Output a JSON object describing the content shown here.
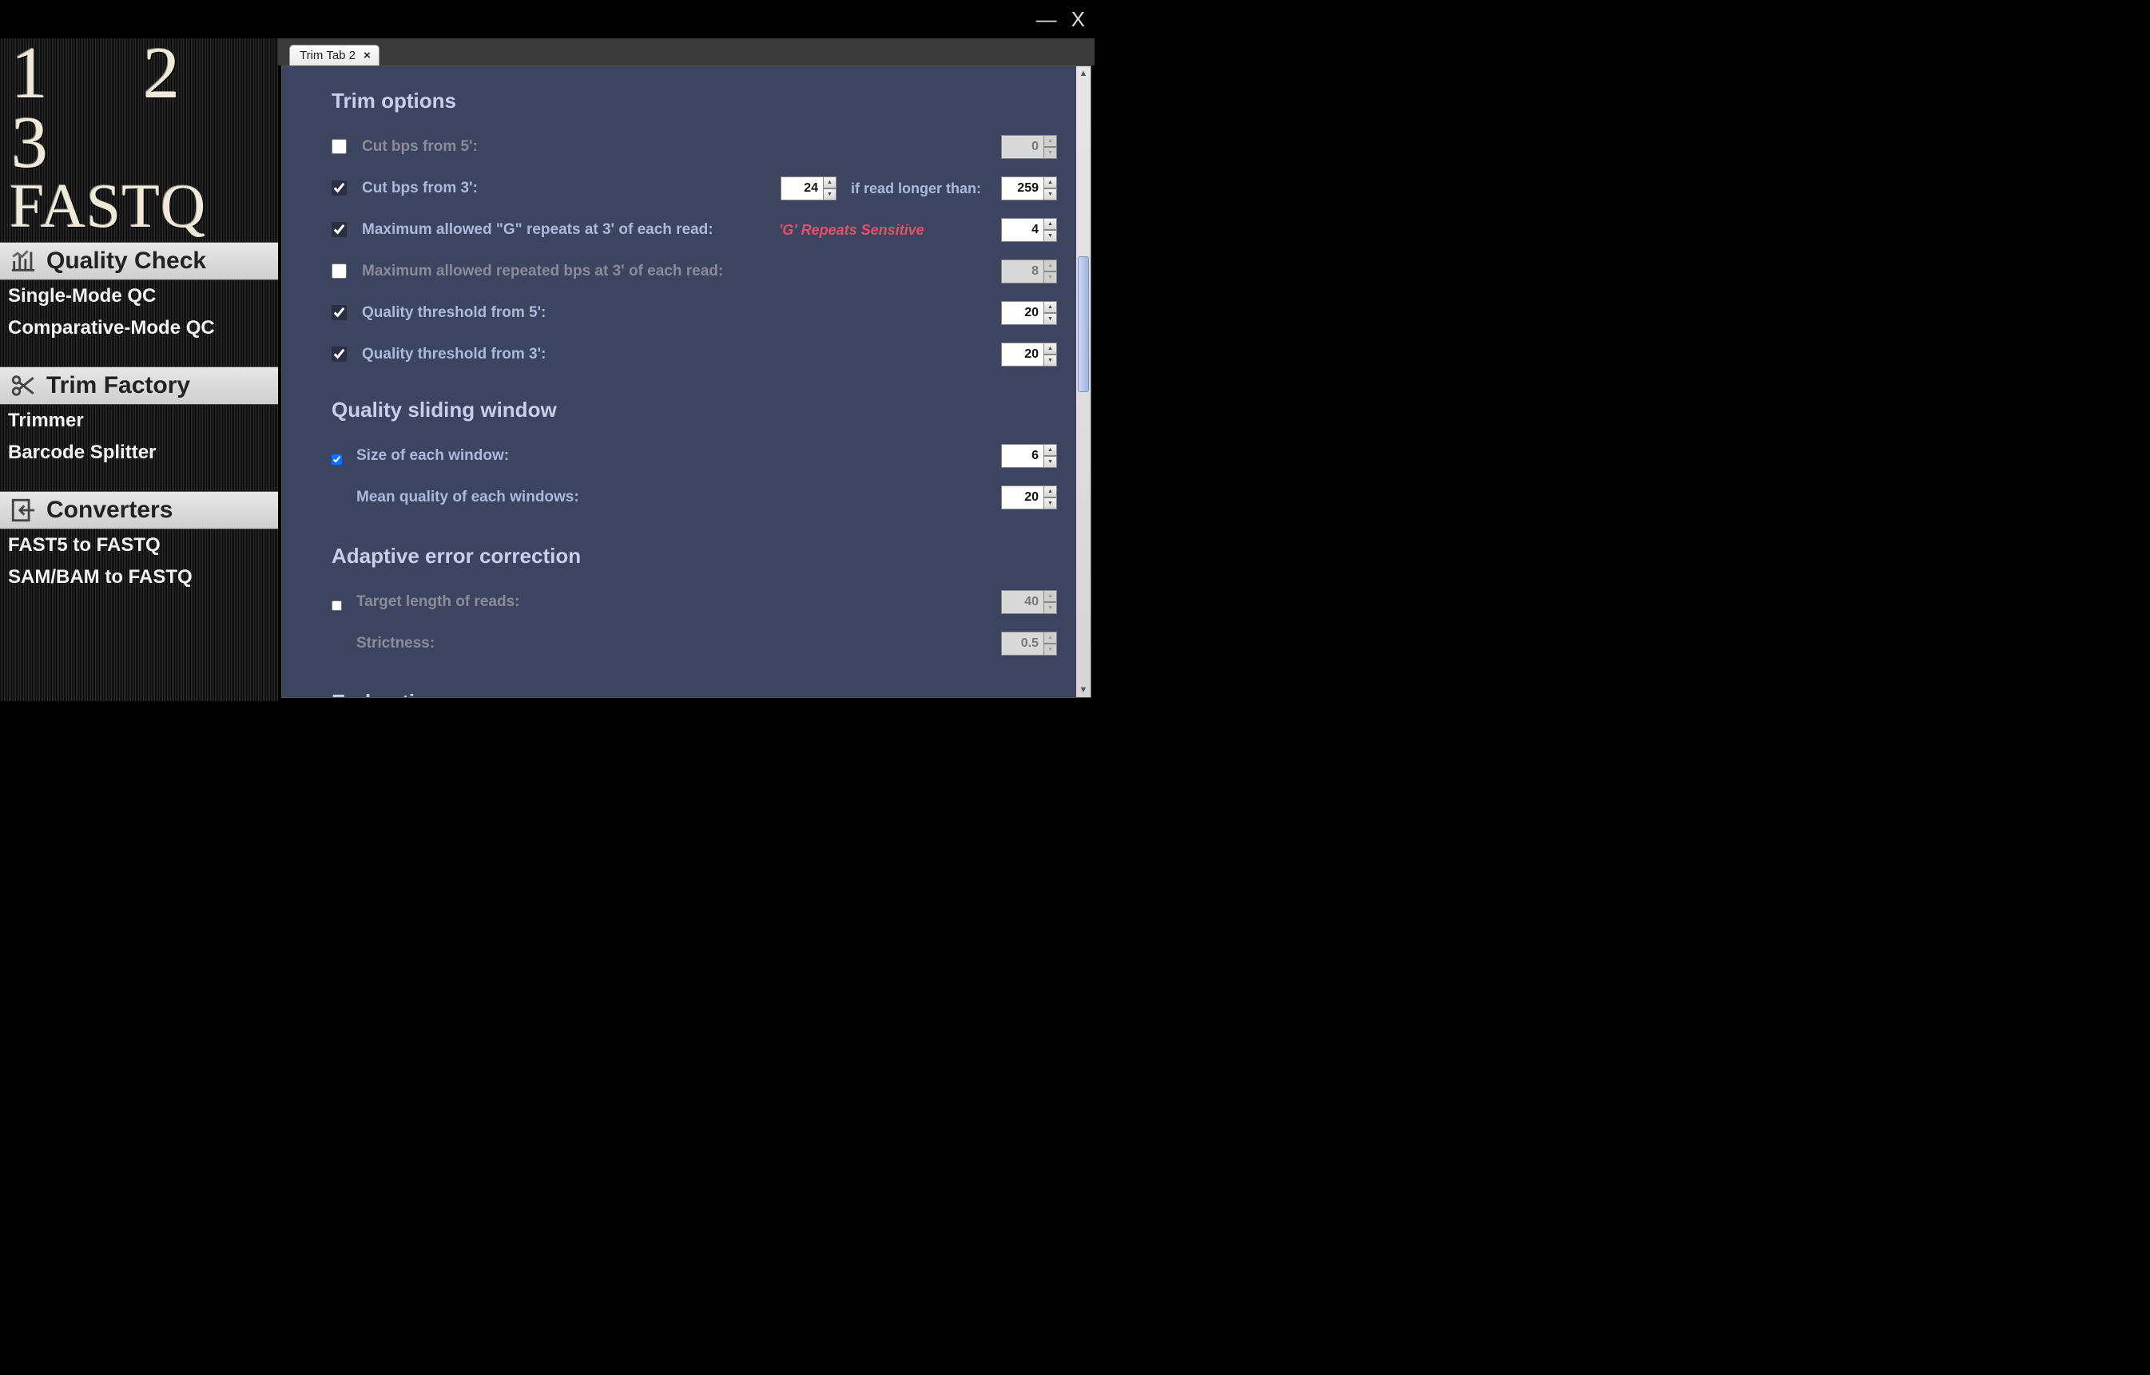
{
  "titlebar": {
    "minimize": "—",
    "close": "X"
  },
  "logo": {
    "numbers": "1 2 3",
    "word": "FASTQ"
  },
  "sidebar": {
    "sections": [
      {
        "header": "Quality Check",
        "icon": "bar-chart-icon",
        "items": [
          "Single-Mode QC",
          "Comparative-Mode QC"
        ]
      },
      {
        "header": "Trim Factory",
        "icon": "scissors-icon",
        "items": [
          "Trimmer",
          "Barcode Splitter"
        ]
      },
      {
        "header": "Converters",
        "icon": "import-icon",
        "items": [
          "FAST5 to FASTQ",
          "SAM/BAM to FASTQ"
        ]
      }
    ]
  },
  "tab": {
    "label": "Trim Tab 2",
    "close": "×"
  },
  "sections": {
    "trim_options": "Trim options",
    "sliding": "Quality sliding window",
    "adaptive": "Adaptive error correction",
    "end": "End options"
  },
  "rows": {
    "cut5": {
      "checked": false,
      "label": "Cut bps from 5':",
      "value": "0"
    },
    "cut3": {
      "checked": true,
      "label": "Cut bps from 3':",
      "value": "24",
      "mid_label": "if read longer than:",
      "value2": "259"
    },
    "maxG": {
      "checked": true,
      "label": "Maximum allowed \"G\" repeats at 3' of each read:",
      "mid_label": "'G' Repeats Sensitive",
      "value": "4"
    },
    "maxRep": {
      "checked": false,
      "label": "Maximum allowed repeated bps at 3' of each read:",
      "value": "8"
    },
    "q5": {
      "checked": true,
      "label": "Quality threshold from 5':",
      "value": "20"
    },
    "q3": {
      "checked": true,
      "label": "Quality threshold from 3':",
      "value": "20"
    },
    "sw": {
      "checked": true,
      "size_label": "Size of each window:",
      "size_value": "6",
      "mean_label": "Mean quality of each windows:",
      "mean_value": "20"
    },
    "adapt": {
      "checked": false,
      "target_label": "Target length of reads:",
      "target_value": "40",
      "strict_label": "Strictness:",
      "strict_value": "0.5"
    }
  }
}
